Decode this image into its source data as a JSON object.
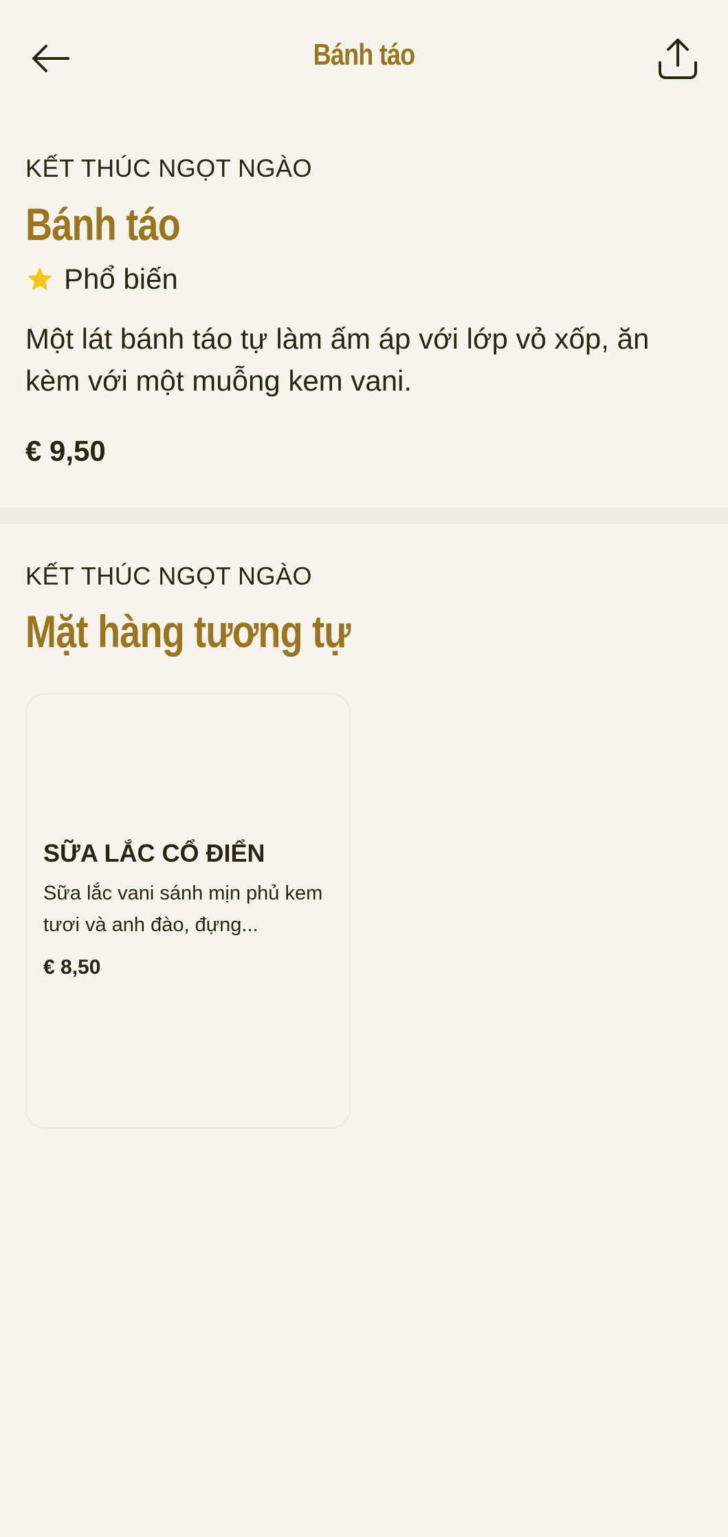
{
  "header": {
    "title": "Bánh táo",
    "back_icon": "arrow-left-icon",
    "share_icon": "share-upload-icon"
  },
  "item": {
    "category": "KẾT THÚC NGỌT NGÀO",
    "name": "Bánh táo",
    "badge": "Phổ biến",
    "badge_icon": "star-icon",
    "description": "Một lát bánh táo tự làm ấm áp với lớp vỏ xốp, ăn kèm với một muỗng kem vani.",
    "price": "€ 9,50"
  },
  "similar": {
    "category": "KẾT THÚC NGỌT NGÀO",
    "title": "Mặt hàng tương tự",
    "items": [
      {
        "name": "SỮA LẮC CỔ ĐIỂN",
        "description": "Sữa lắc vani sánh mịn phủ kem tươi và anh đào, đựng...",
        "price": "€ 8,50"
      }
    ]
  },
  "colors": {
    "background": "#F7F4EE",
    "accent": "#9A7520",
    "text": "#2A2410",
    "star": "#F5C518",
    "divider": "#EFECE4"
  }
}
